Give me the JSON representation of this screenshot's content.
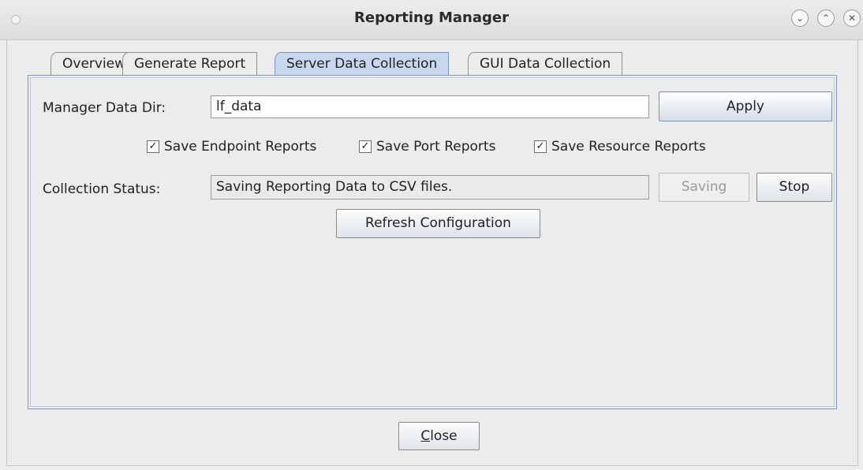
{
  "window": {
    "title": "Reporting Manager"
  },
  "titlebar_controls": {
    "minimize_icon": "chevron-down-icon",
    "maximize_icon": "chevron-up-icon",
    "close_icon": "close-icon"
  },
  "tabs": [
    {
      "label": "Overview"
    },
    {
      "label": "Generate Report"
    },
    {
      "label": "Server Data Collection",
      "active": true
    },
    {
      "label": "GUI Data Collection"
    }
  ],
  "server": {
    "data_dir_label": "Manager Data Dir:",
    "data_dir_value": "lf_data",
    "apply_label": "Apply",
    "checkboxes": [
      {
        "label": "Save Endpoint Reports",
        "checked": true
      },
      {
        "label": "Save Port Reports",
        "checked": true
      },
      {
        "label": "Save Resource Reports",
        "checked": true
      }
    ],
    "status_label": "Collection Status:",
    "status_value": "Saving Reporting Data to CSV files.",
    "saving_label": "Saving",
    "stop_label": "Stop",
    "refresh_label": "Refresh Configuration"
  },
  "footer": {
    "close_mnemonic": "C",
    "close_rest": "lose"
  }
}
